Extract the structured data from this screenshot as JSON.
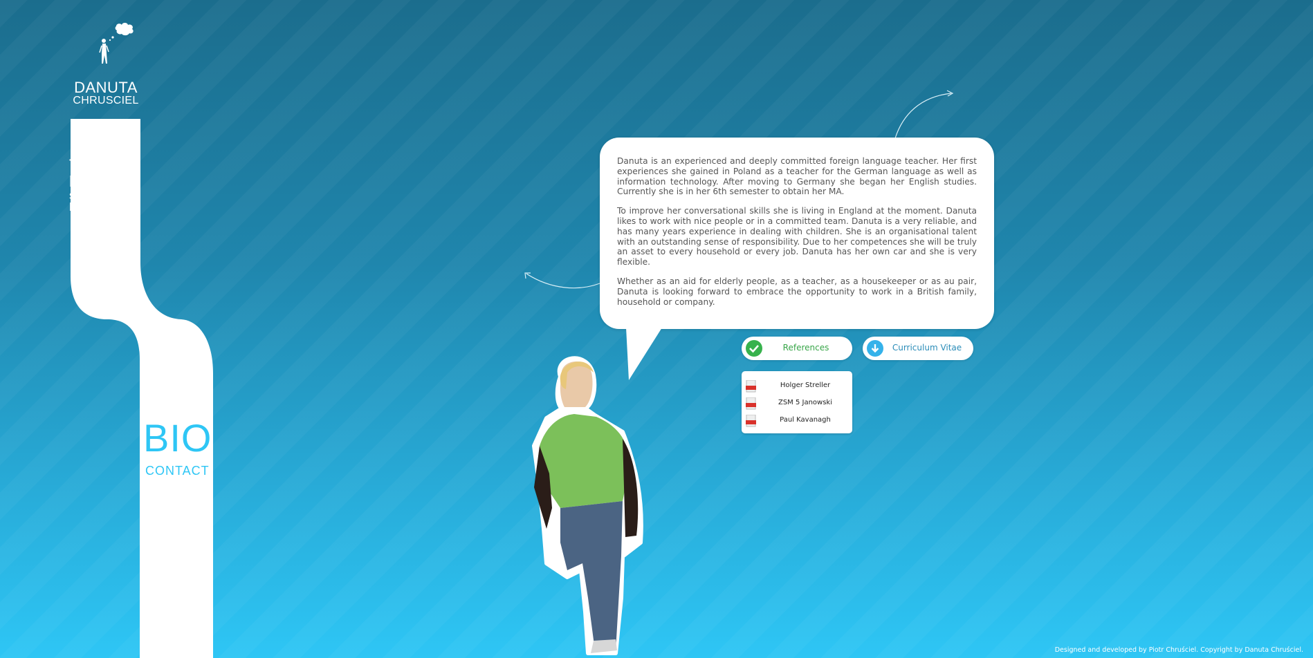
{
  "brand": {
    "first_name": "DANUTA",
    "last_name": "CHRUSCIEL"
  },
  "roles": [
    "teacher",
    "babysitter",
    "social worker",
    "house keeper"
  ],
  "nav": {
    "bio": "BIO",
    "contact": "CONTACT"
  },
  "bio": {
    "paragraphs": [
      "Danuta is an experienced and deeply committed foreign language teacher. Her first experiences she gained in Poland as a teacher for the German language as well as information technology. After moving to Germany she began her English studies. Currently she is in her 6th semester to obtain her MA.",
      "To improve her conversational skills she is living in England at the moment. Danuta likes to work with nice people or in a committed team. Danuta is a very reliable, and has many years experience in dealing with children. She is an organisational talent with an outstanding sense of responsibility. Due to her competences she will be truly an asset to every household or every job. Danuta has her own car and she is very flexible.",
      "Whether as an aid for elderly people, as a teacher, as a housekeeper or as au pair, Danuta is looking forward to embrace the opportunity to work in a British family, household or company."
    ]
  },
  "buttons": {
    "references": "References",
    "cv": "Curriculum Vitae"
  },
  "references": [
    "Holger Streller",
    "ZSM 5 Janowski",
    "Paul Kavanagh"
  ],
  "footer": "Designed and developed by Piotr Chruściel. Copyright by Danuta Chruściel.",
  "colors": {
    "accent": "#2ec6f5",
    "check": "#37b24d",
    "download": "#35b2ea",
    "pdf": "#d9322b"
  },
  "icons": {
    "logo": "woman-thought-bubble-icon",
    "references": "check-icon",
    "cv": "download-icon",
    "reference_item": "pdf-icon"
  }
}
